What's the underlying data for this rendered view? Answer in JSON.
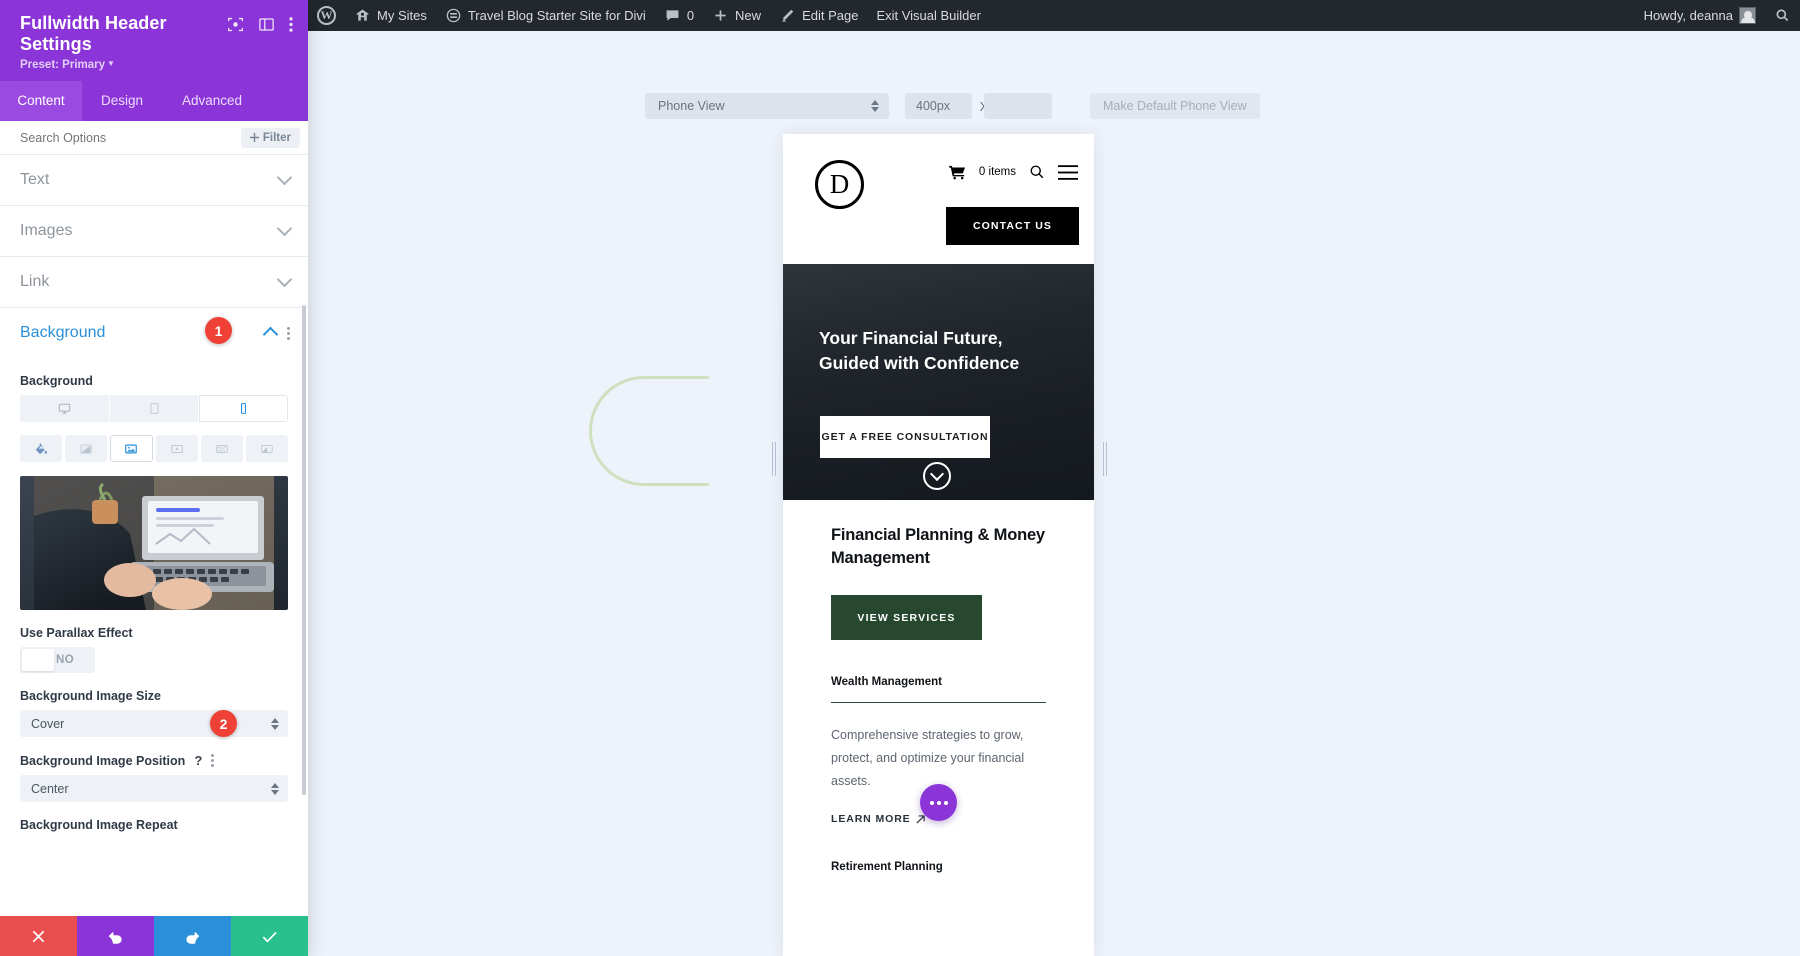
{
  "admin_bar": {
    "items": [
      {
        "name": "wp-logo",
        "label": ""
      },
      {
        "name": "my-sites",
        "label": "My Sites"
      },
      {
        "name": "site-name",
        "label": "Travel Blog Starter Site for Divi"
      },
      {
        "name": "comments",
        "label": "0"
      },
      {
        "name": "new",
        "label": "New"
      },
      {
        "name": "edit-page",
        "label": "Edit Page"
      },
      {
        "name": "exit-visual-builder",
        "label": "Exit Visual Builder"
      }
    ],
    "howdy": "Howdy, deanna"
  },
  "panel": {
    "title": "Fullwidth Header Settings",
    "preset": "Preset: Primary",
    "tabs": [
      {
        "label": "Content",
        "active": true
      },
      {
        "label": "Design",
        "active": false
      },
      {
        "label": "Advanced",
        "active": false
      }
    ],
    "search_placeholder": "Search Options",
    "filter_label": "Filter",
    "sections": [
      {
        "label": "Text",
        "open": false
      },
      {
        "label": "Images",
        "open": false
      },
      {
        "label": "Link",
        "open": false
      },
      {
        "label": "Background",
        "open": true
      }
    ],
    "background": {
      "field_label": "Background",
      "devices": [
        {
          "name": "desktop",
          "active": false
        },
        {
          "name": "tablet",
          "active": false
        },
        {
          "name": "phone",
          "active": true
        }
      ],
      "types": [
        {
          "name": "background-color",
          "active": false
        },
        {
          "name": "background-gradient",
          "active": false
        },
        {
          "name": "background-image",
          "active": true
        },
        {
          "name": "background-video",
          "active": false
        },
        {
          "name": "background-pattern",
          "active": false
        },
        {
          "name": "background-mask",
          "active": false
        }
      ],
      "parallax_label": "Use Parallax Effect",
      "parallax_value": "NO",
      "image_size_label": "Background Image Size",
      "image_size_value": "Cover",
      "image_position_label": "Background Image Position",
      "image_position_value": "Center",
      "image_repeat_label": "Background Image Repeat"
    },
    "actions": [
      {
        "name": "cancel",
        "icon": "close-icon",
        "color": "#e94f4f"
      },
      {
        "name": "undo",
        "icon": "undo-icon",
        "color": "#8b34d7"
      },
      {
        "name": "redo",
        "icon": "redo-icon",
        "color": "#2a90d9"
      },
      {
        "name": "save",
        "icon": "check-icon",
        "color": "#2ac08e"
      }
    ]
  },
  "responsive_bar": {
    "view_label": "Phone View",
    "width_value": "400px",
    "separator": "X",
    "height_value": "",
    "make_default_label": "Make Default Phone View"
  },
  "preview": {
    "logo_letter": "D",
    "cart_label": "0 items",
    "contact_button": "CONTACT US",
    "hero": {
      "title_line1": "Your Financial Future,",
      "title_line2": "Guided with Confidence",
      "cta": "GET A FREE CONSULTATION"
    },
    "services": {
      "heading_line1": "Financial Planning & Money",
      "heading_line2": "Management",
      "button": "VIEW SERVICES",
      "items": [
        {
          "title": "Wealth Management",
          "description": "Comprehensive strategies to grow, protect, and optimize your financial assets.",
          "learn_more": "LEARN MORE"
        },
        {
          "title": "Retirement Planning",
          "description": "",
          "learn_more": ""
        }
      ]
    }
  },
  "badges": [
    {
      "label": "1"
    },
    {
      "label": "2"
    }
  ],
  "colors": {
    "divi_purple": "#8b34d7",
    "admin_dark": "#23282d",
    "accent_blue": "#2a90d9",
    "badge_red": "#ef4136",
    "green_button": "#27472f",
    "canvas": "#eef2fa"
  }
}
